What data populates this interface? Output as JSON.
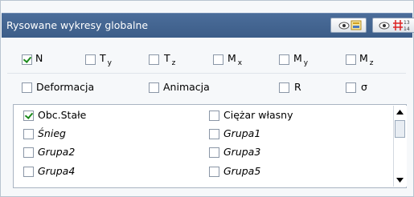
{
  "panel": {
    "title": "Rysowane wykresy globalne"
  },
  "header_buttons": [
    {
      "icon": "eye-table-icon"
    },
    {
      "icon": "eye-numbers-icon"
    }
  ],
  "components": [
    {
      "base": "N",
      "sub": "",
      "checked": true
    },
    {
      "base": "T",
      "sub": "y",
      "checked": false
    },
    {
      "base": "T",
      "sub": "z",
      "checked": false
    },
    {
      "base": "M",
      "sub": "x",
      "checked": false
    },
    {
      "base": "M",
      "sub": "y",
      "checked": false
    },
    {
      "base": "M",
      "sub": "z",
      "checked": false
    }
  ],
  "options": [
    {
      "label": "Deformacja",
      "checked": false
    },
    {
      "label": "Animacja",
      "checked": false
    },
    {
      "label": "R",
      "checked": false
    },
    {
      "label": "σ",
      "checked": false
    }
  ],
  "load_groups": [
    {
      "label": "Obc.Stałe",
      "checked": true,
      "italic": false
    },
    {
      "label": "Ciężar własny",
      "checked": false,
      "italic": false
    },
    {
      "label": "Śnieg",
      "checked": false,
      "italic": true
    },
    {
      "label": "Grupa1",
      "checked": false,
      "italic": true
    },
    {
      "label": "Grupa2",
      "checked": false,
      "italic": true
    },
    {
      "label": "Grupa3",
      "checked": false,
      "italic": true
    },
    {
      "label": "Grupa4",
      "checked": false,
      "italic": true
    },
    {
      "label": "Grupa5",
      "checked": false,
      "italic": true
    }
  ]
}
